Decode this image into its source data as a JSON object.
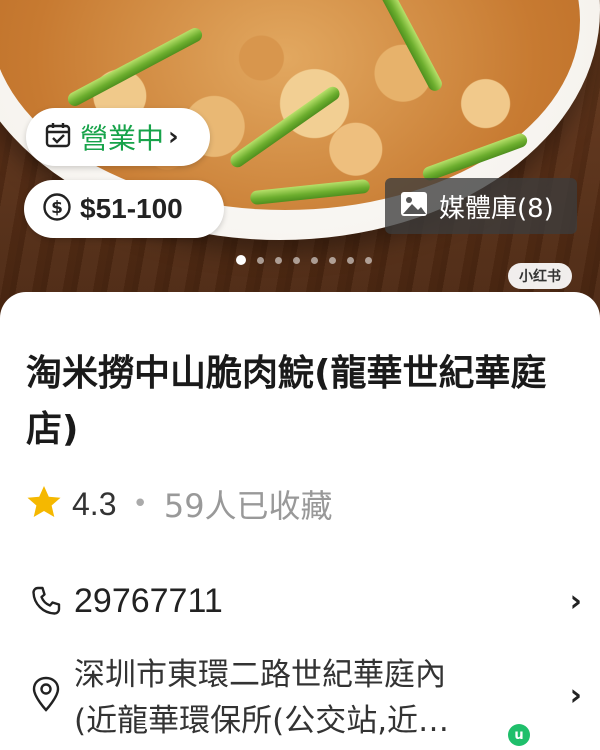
{
  "hero": {
    "open_status": "營業中",
    "price_range": "$51-100",
    "media_button": "媒體庫(8)",
    "watermark": "小红书",
    "carousel": {
      "total": 8,
      "active_index": 0
    }
  },
  "restaurant": {
    "name": "淘米撈中山脆肉鯇(龍華世紀華庭店)",
    "rating": "4.3",
    "favorites": "59人已收藏",
    "phone": "29767711",
    "address": "深圳市東環二路世紀華庭內(近龍華環保所(公交站,近…",
    "address_line1": "深圳市東環二路世紀華庭內",
    "address_line2": "(近龍華環保所(公交站,近…"
  },
  "icons": {
    "open_status": "calendar-check-icon",
    "price": "dollar-circle-icon",
    "media": "image-icon",
    "rating": "star-icon",
    "phone": "phone-icon",
    "address": "location-pin-icon",
    "chevron": "chevron-right-icon"
  },
  "colors": {
    "open_green": "#17a34a",
    "star": "#f5b800",
    "badge_green": "#1fbf6b"
  }
}
